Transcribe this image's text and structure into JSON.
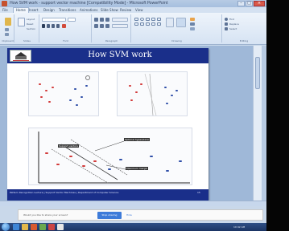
{
  "window": {
    "title": "How SVM work - support vector machine [Compatibility Mode] - Microsoft PowerPoint",
    "minimize": "–",
    "maximize": "□",
    "close": "×"
  },
  "ribbon": {
    "tabs": [
      "File",
      "Home",
      "Insert",
      "Design",
      "Transitions",
      "Animations",
      "Slide Show",
      "Review",
      "View"
    ],
    "groups": {
      "clipboard": "Clipboard",
      "slides": "Slides",
      "font": "Font",
      "paragraph": "Paragraph",
      "drawing": "Drawing",
      "editing": "Editing"
    },
    "editing_items": [
      "Find",
      "Replace",
      "Select"
    ],
    "slides_items": [
      "Layout",
      "Reset",
      "Section"
    ]
  },
  "slide": {
    "title": "How SVM work",
    "annotations": {
      "hyperplane_label": "Optimal hyperplane",
      "margin_label": "Maximum margin",
      "support_vectors_label": "Support vectors"
    },
    "footer_text": "Pattern Recognition Lecture  |  Support Vector Machines  |  Department of Computer Science",
    "page_number": "15"
  },
  "notification": {
    "text": "Would you like to share your screen?",
    "button": "Stop sharing",
    "link": "Hide"
  },
  "colors": {
    "slide_header": "#1a2f8a",
    "point_red": "#d23a3a",
    "point_blue": "#2f4fa8",
    "taskbar": "#1c3564"
  },
  "taskbar": {
    "clock": "10:42 AM"
  }
}
